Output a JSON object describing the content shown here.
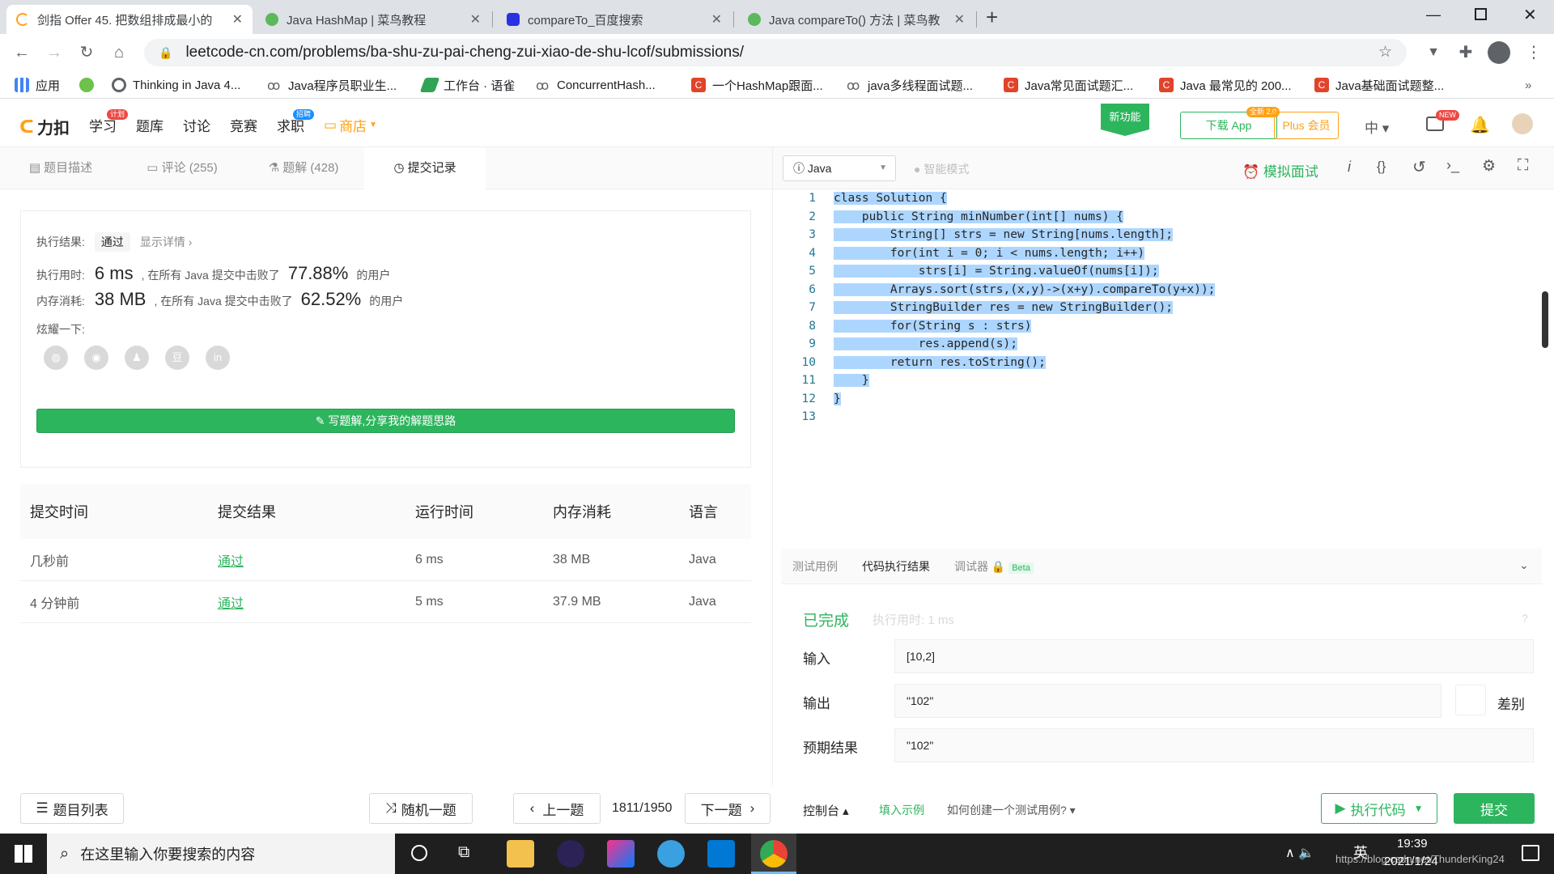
{
  "browser": {
    "tabs": [
      {
        "title": "剑指 Offer 45. 把数组排成最小的",
        "active": true
      },
      {
        "title": "Java HashMap | 菜鸟教程",
        "active": false
      },
      {
        "title": "compareTo_百度搜索",
        "active": false
      },
      {
        "title": "Java compareTo() 方法 | 菜鸟教",
        "active": false
      }
    ],
    "new_tab": "+",
    "url": "leetcode-cn.com/problems/ba-shu-zu-pai-cheng-zui-xiao-de-shu-lcof/submissions/",
    "bookmarks": [
      "应用",
      "Thinking in Java 4...",
      "Java程序员职业生...",
      "工作台 · 语雀",
      "ConcurrentHash...",
      "一个HashMap跟面...",
      "java多线程面试题...",
      "Java常见面试题汇...",
      "Java 最常见的 200...",
      "Java基础面试题整..."
    ],
    "more": "»"
  },
  "site": {
    "logo": "力扣",
    "nav": [
      "学习",
      "题库",
      "讨论",
      "竞赛",
      "求职",
      "商店"
    ],
    "nav_badges": {
      "study": "计划",
      "job": "招聘"
    },
    "new_feature": "新功能",
    "download_app": "下载 App",
    "download_badge": "全新 2.0",
    "plus": "Plus 会员",
    "lang": "中",
    "new_badge": "NEW"
  },
  "left_tabs": [
    {
      "label": "题目描述"
    },
    {
      "label": "评论 (255)"
    },
    {
      "label": "题解 (428)"
    },
    {
      "label": "提交记录"
    }
  ],
  "result": {
    "status_label": "执行结果:",
    "status": "通过",
    "details": "显示详情 ›",
    "time_label": "执行用时:",
    "time_value": "6 ms",
    "time_text": ", 在所有 Java 提交中击败了",
    "time_pct": "77.88%",
    "time_suffix": "的用户",
    "mem_label": "内存消耗:",
    "mem_value": "38 MB",
    "mem_text": ", 在所有 Java 提交中击败了",
    "mem_pct": "62.52%",
    "mem_suffix": "的用户",
    "share_label": "炫耀一下:",
    "share_icons": [
      "wechat-icon",
      "weibo-icon",
      "qq-icon",
      "douban-icon",
      "linkedin-icon"
    ],
    "write_btn": "写题解,分享我的解题思路"
  },
  "submissions": {
    "headers": [
      "提交时间",
      "提交结果",
      "运行时间",
      "内存消耗",
      "语言"
    ],
    "rows": [
      [
        "几秒前",
        "通过",
        "6 ms",
        "38 MB",
        "Java"
      ],
      [
        "4 分钟前",
        "通过",
        "5 ms",
        "37.9 MB",
        "Java"
      ]
    ]
  },
  "bottom_left": {
    "list": "题目列表",
    "random": "随机一题",
    "prev": "上一题",
    "counter": "1811/1950",
    "next": "下一题"
  },
  "editor": {
    "language": "Java",
    "smart_mode": "智能模式",
    "mock": "模拟面试",
    "code": [
      "class Solution {",
      "    public String minNumber(int[] nums) {",
      "        String[] strs = new String[nums.length];",
      "        for(int i = 0; i < nums.length; i++)",
      "            strs[i] = String.valueOf(nums[i]);",
      "        Arrays.sort(strs,(x,y)->(x+y).compareTo(y+x));",
      "        StringBuilder res = new StringBuilder();",
      "        for(String s : strs)",
      "            res.append(s);",
      "        return res.toString();",
      "    }",
      "}",
      ""
    ]
  },
  "console": {
    "tabs": [
      "测试用例",
      "代码执行结果",
      "调试器"
    ],
    "beta": "Beta",
    "done": "已完成",
    "exec_time": "执行用时: 1 ms",
    "input_label": "输入",
    "input_value": "[10,2]",
    "output_label": "输出",
    "output_value": "\"102\"",
    "diff": "差别",
    "expected_label": "预期结果",
    "expected_value": "\"102\""
  },
  "bottom_right": {
    "console": "控制台",
    "fill_example": "填入示例",
    "how_to": "如何创建一个测试用例?",
    "run": "执行代码",
    "submit": "提交"
  },
  "taskbar": {
    "search_placeholder": "在这里输入你要搜索的内容",
    "ime": "英",
    "time": "19:39",
    "date": "2021/1/24",
    "watermark": "https://blog.csdn.net/ThunderKing24"
  },
  "colors": {
    "green": "#2db55d",
    "accent_orange": "#ffa116",
    "highlight": "#add6ff"
  }
}
